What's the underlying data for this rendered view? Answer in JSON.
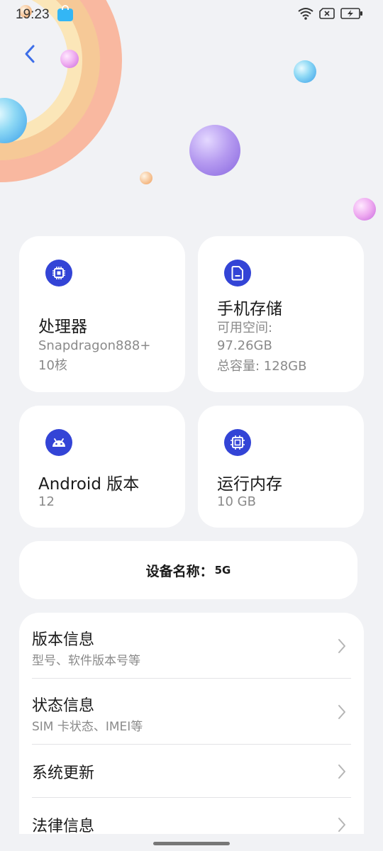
{
  "status_bar": {
    "time": "19:23"
  },
  "tiles": {
    "processor": {
      "title": "处理器",
      "line1": "Snapdragon888+",
      "line2": "10核"
    },
    "storage": {
      "title": "手机存储",
      "line1": "可用空间:",
      "line2": "97.26GB",
      "line3": "总容量: 128GB"
    },
    "android": {
      "title": "Android 版本",
      "value": "12"
    },
    "ram": {
      "title": "运行内存",
      "value": "10 GB"
    }
  },
  "device_name": {
    "label": "设备名称：",
    "value": "5G"
  },
  "menu": [
    {
      "title": "版本信息",
      "subtitle": "型号、软件版本号等"
    },
    {
      "title": "状态信息",
      "subtitle": "SIM 卡状态、IMEI等"
    },
    {
      "title": "系统更新"
    },
    {
      "title": "法律信息"
    }
  ],
  "colors": {
    "accent": "#3344d6",
    "background": "#f1f2f5",
    "card": "#ffffff"
  }
}
